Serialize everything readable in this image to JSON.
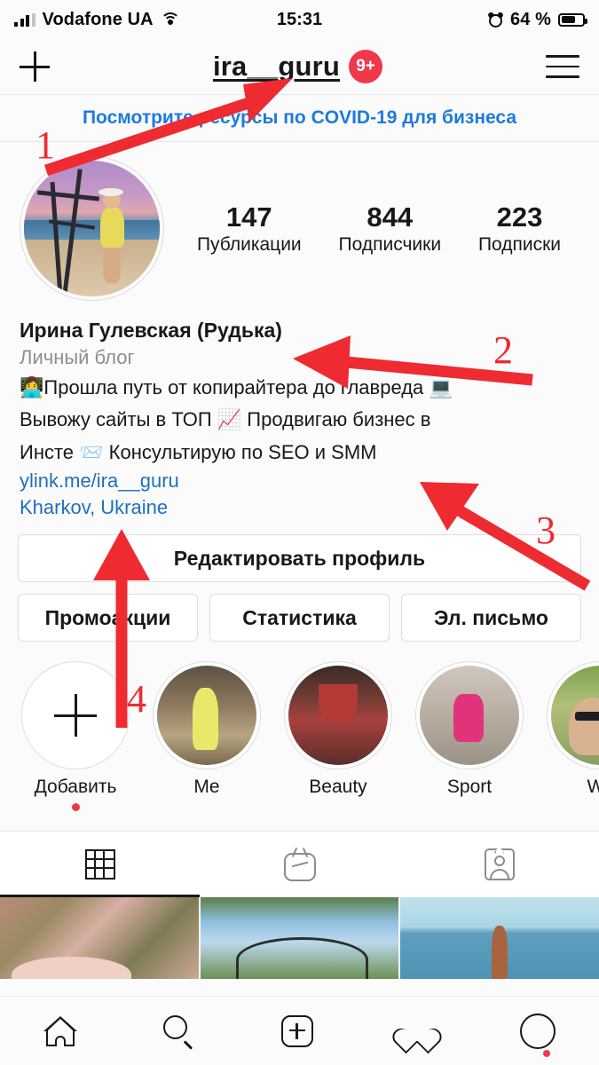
{
  "status_bar": {
    "carrier": "Vodafone UA",
    "time": "15:31",
    "battery_text": "64 %",
    "signal_icon": "signal-bars-icon",
    "wifi_icon": "wifi-icon",
    "alarm_icon": "alarm-clock-icon",
    "battery_icon": "battery-icon"
  },
  "header": {
    "add_icon": "plus-icon",
    "username": "ira__guru",
    "badge": "9+",
    "menu_icon": "hamburger-menu-icon"
  },
  "banner": {
    "text": "Посмотрите ресурсы по COVID-19 для бизнеса"
  },
  "profile": {
    "avatar_alt": "profile-photo",
    "stats": [
      {
        "number": "147",
        "label": "Публикации"
      },
      {
        "number": "844",
        "label": "Подписчики"
      },
      {
        "number": "223",
        "label": "Подписки"
      }
    ],
    "full_name": "Ирина Гулевская (Рудька)",
    "category": "Личный блог",
    "bio_line1": "👩‍💻Прошла путь от копирайтера до главреда 💻",
    "bio_line2": "Вывожу сайты в ТОП 📈 Продвигаю бизнес в",
    "bio_line3": "Инсте 📨 Консультирую по SEO и SMM",
    "website": "ylink.me/ira__guru",
    "location": "Kharkov, Ukraine"
  },
  "actions": {
    "edit_profile": "Редактировать профиль",
    "promotions": "Промоакции",
    "statistics": "Статистика",
    "email": "Эл. письмо"
  },
  "highlights": [
    {
      "label": "Добавить",
      "icon": "add-highlight-icon",
      "has_dot": true
    },
    {
      "label": "Me",
      "icon": "highlight-cover-me"
    },
    {
      "label": "Beauty",
      "icon": "highlight-cover-beauty"
    },
    {
      "label": "Sport",
      "icon": "highlight-cover-sport"
    },
    {
      "label": "We",
      "icon": "highlight-cover-we"
    }
  ],
  "tabs": [
    {
      "name": "grid-tab",
      "icon": "grid-icon",
      "active": true
    },
    {
      "name": "igtv-tab",
      "icon": "igtv-icon",
      "active": false
    },
    {
      "name": "tagged-tab",
      "icon": "tagged-person-icon",
      "active": false
    }
  ],
  "bottom_nav": [
    {
      "name": "home-tab",
      "icon": "home-icon"
    },
    {
      "name": "search-tab",
      "icon": "search-icon"
    },
    {
      "name": "add-post-tab",
      "icon": "add-square-icon"
    },
    {
      "name": "activity-tab",
      "icon": "heart-icon"
    },
    {
      "name": "profile-tab",
      "icon": "profile-avatar-icon"
    }
  ],
  "annotations": [
    {
      "number": "1",
      "target": "username"
    },
    {
      "number": "2",
      "target": "full-name"
    },
    {
      "number": "3",
      "target": "bio-text"
    },
    {
      "number": "4",
      "target": "location"
    }
  ],
  "colors": {
    "accent_red": "#ee2b30",
    "badge_red": "#f0384a",
    "link_blue": "#1f6fbd",
    "banner_blue": "#1d7ae0",
    "text": "#17181a",
    "muted": "#8e8e93"
  }
}
